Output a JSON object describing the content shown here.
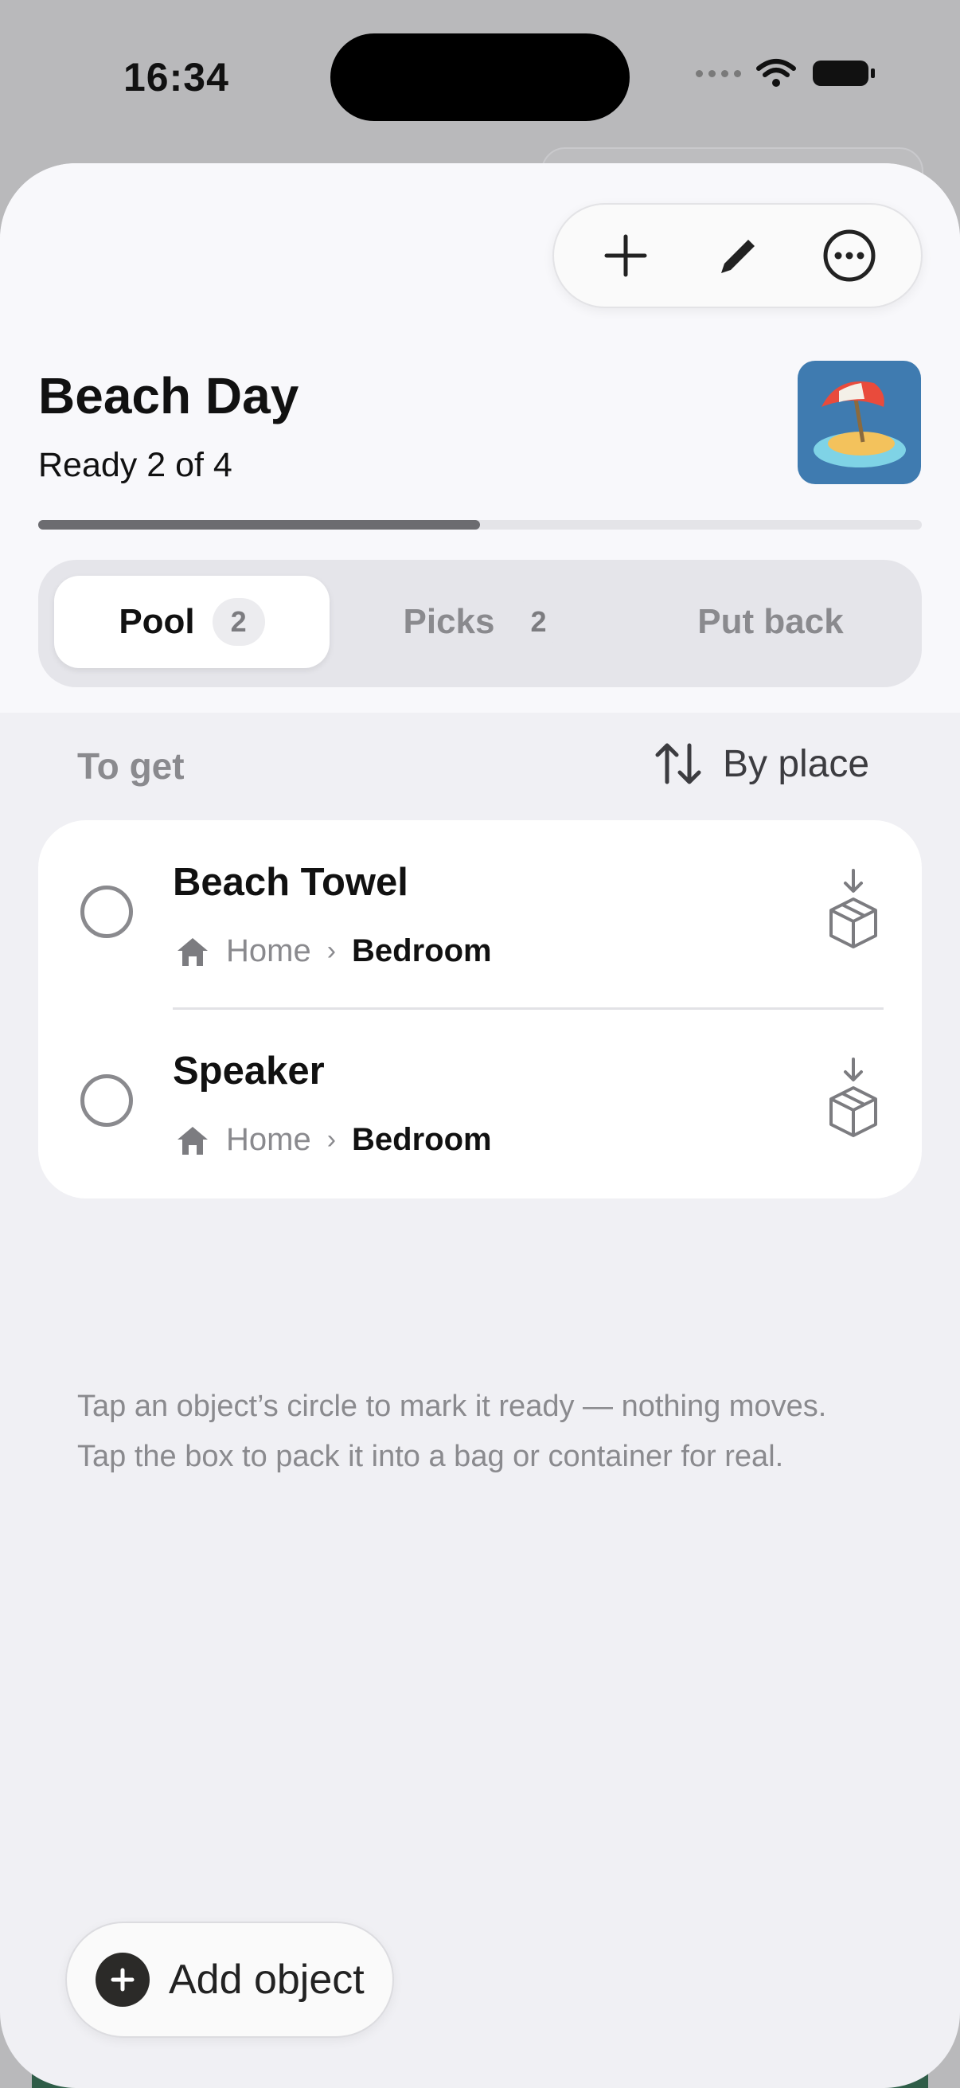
{
  "status_bar": {
    "time": "16:34"
  },
  "header": {
    "title": "Beach Day",
    "subtitle": "Ready 2 of 4",
    "progress_fraction": 0.5,
    "toolbar_icons": [
      "plus-icon",
      "pencil-icon",
      "more-circle-icon"
    ],
    "list_icon": "beach-umbrella-emoji"
  },
  "tabs": [
    {
      "label": "Pool",
      "count": "2",
      "active": true
    },
    {
      "label": "Picks",
      "count": "2",
      "active": false
    },
    {
      "label": "Put back",
      "count": null,
      "active": false
    }
  ],
  "section": {
    "title": "To get",
    "sort_label": "By place",
    "sort_icon": "sort-arrows-icon"
  },
  "items": [
    {
      "name": "Beach Towel",
      "home": "Home",
      "room": "Bedroom"
    },
    {
      "name": "Speaker",
      "home": "Home",
      "room": "Bedroom"
    }
  ],
  "hint": {
    "line1": "Tap an object’s circle to mark it ready — nothing moves.",
    "line2": "Tap the box to pack it into a bag or container for real."
  },
  "add_button": {
    "label": "Add object"
  },
  "colors": {
    "sheet_background": "#f0f0f4",
    "card_background": "#ffffff",
    "accent_dark": "#2b2a28",
    "progress_fill": "#6c6c70",
    "muted_text": "#8a8a8e"
  }
}
